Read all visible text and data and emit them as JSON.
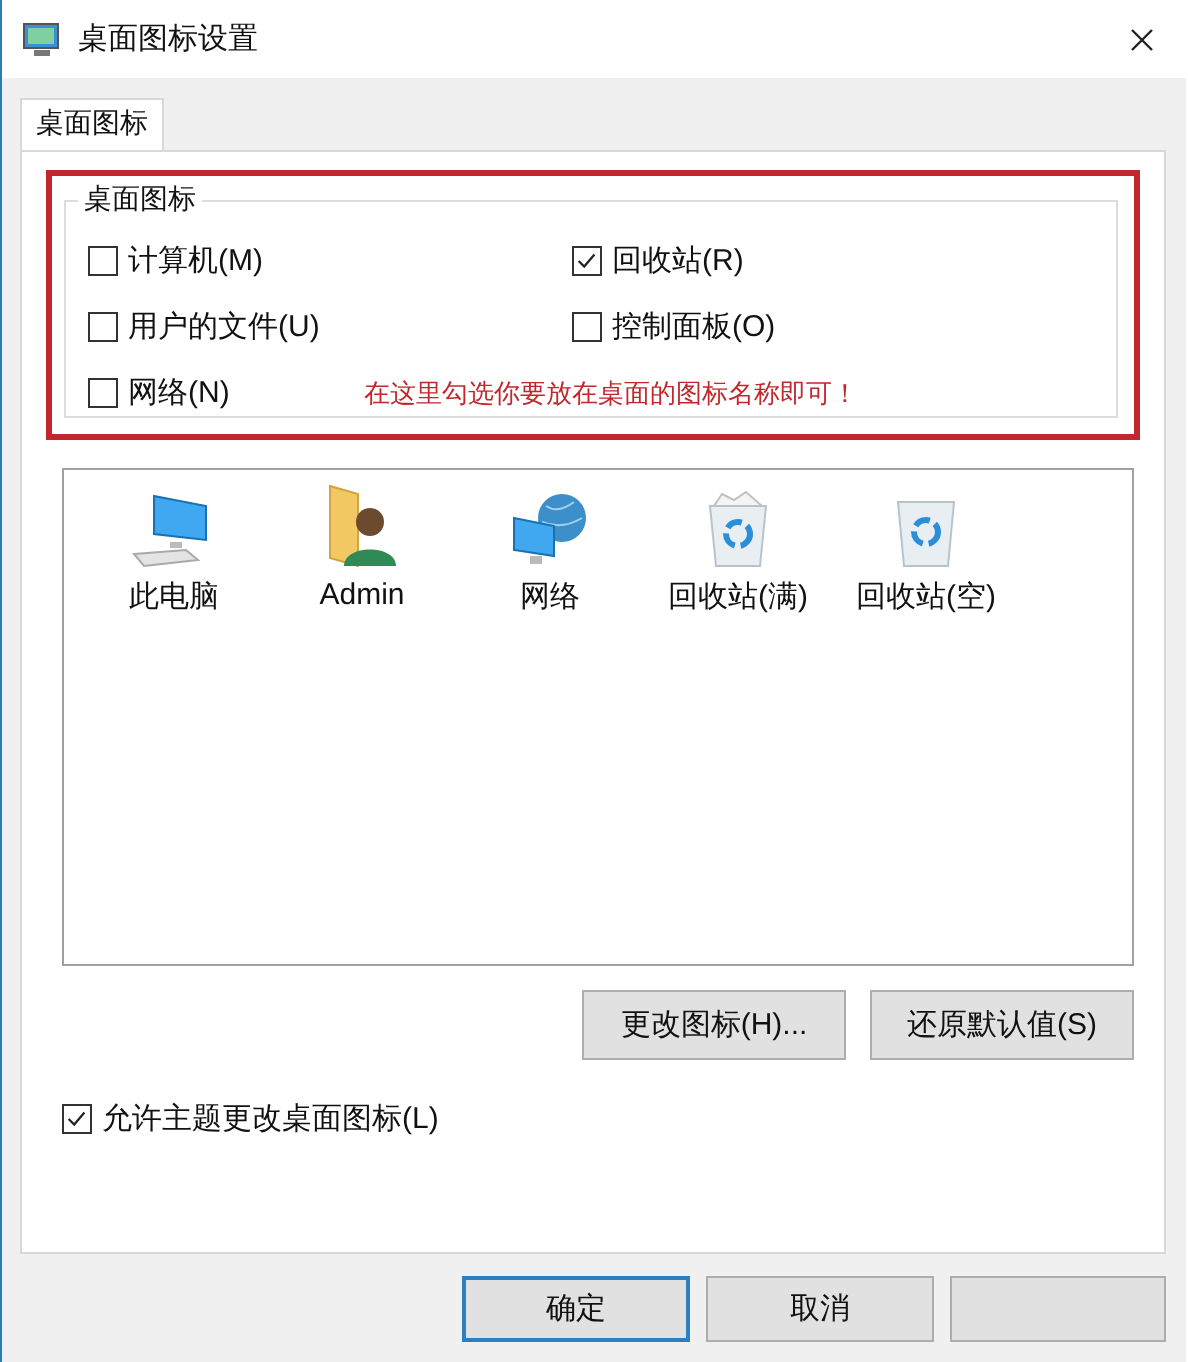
{
  "window": {
    "title": "桌面图标设置"
  },
  "tabs": [
    {
      "label": "桌面图标",
      "selected": true
    }
  ],
  "group": {
    "title": "桌面图标",
    "checkboxes": [
      {
        "label": "计算机(M)",
        "checked": false
      },
      {
        "label": "回收站(R)",
        "checked": true
      },
      {
        "label": "用户的文件(U)",
        "checked": false
      },
      {
        "label": "控制面板(O)",
        "checked": false
      },
      {
        "label": "网络(N)",
        "checked": false
      }
    ],
    "note": "在这里勾选你要放在桌面的图标名称即可！"
  },
  "icons": [
    {
      "label": "此电脑",
      "kind": "computer"
    },
    {
      "label": "Admin",
      "kind": "user"
    },
    {
      "label": "网络",
      "kind": "network"
    },
    {
      "label": "回收站(满)",
      "kind": "bin-full"
    },
    {
      "label": "回收站(空)",
      "kind": "bin-empty"
    }
  ],
  "buttons": [
    {
      "label": "更改图标(H)..."
    },
    {
      "label": "还原默认值(S)"
    }
  ],
  "theme_checkbox": {
    "label": "允许主题更改桌面图标(L)",
    "checked": true
  },
  "footer_buttons": [
    {
      "label": "确定",
      "default": true
    },
    {
      "label": "取消",
      "default": false
    }
  ]
}
